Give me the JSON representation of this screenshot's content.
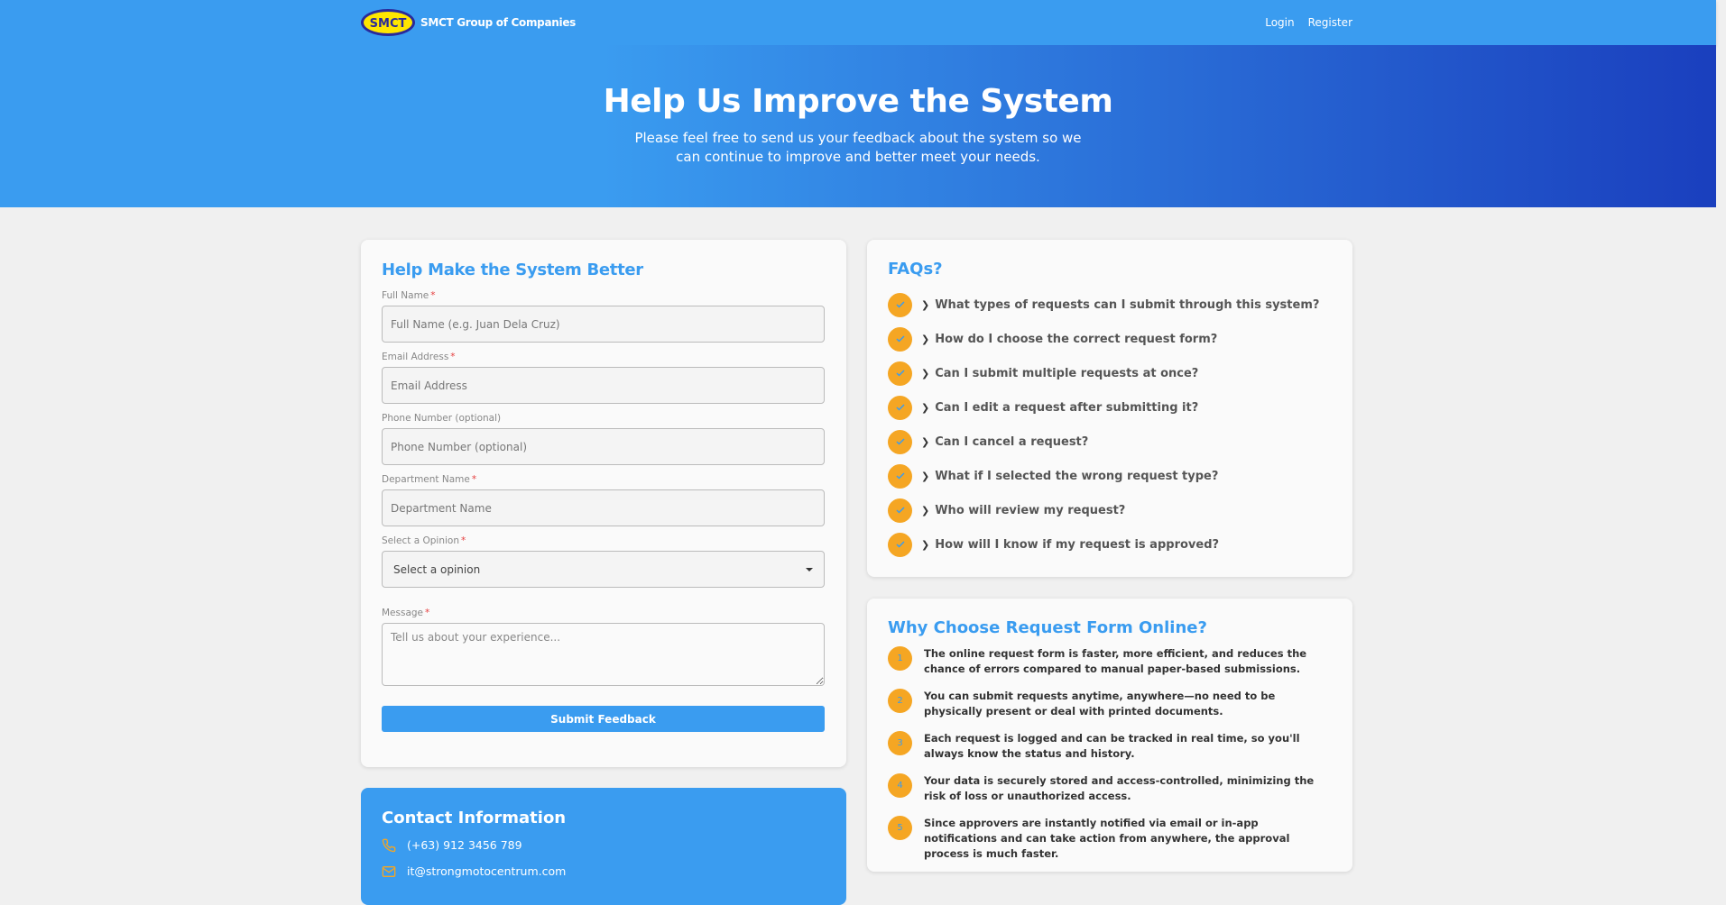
{
  "nav": {
    "logo_text": "SMCT",
    "brand": "SMCT Group of Companies",
    "login": "Login",
    "register": "Register"
  },
  "hero": {
    "title": "Help Us Improve the System",
    "subtitle": "Please feel free to send us your feedback about the system so we can continue to improve and better meet your needs."
  },
  "form": {
    "title": "Help Make the System Better",
    "required_mark": "*",
    "full_name": {
      "label": "Full Name",
      "placeholder": "Full Name (e.g. Juan Dela Cruz)"
    },
    "email": {
      "label": "Email Address",
      "placeholder": "Email Address"
    },
    "phone": {
      "label": "Phone Number (optional)",
      "placeholder": "Phone Number (optional)"
    },
    "department": {
      "label": "Department Name",
      "placeholder": "Department Name"
    },
    "opinion": {
      "label": "Select a Opinion",
      "selected": "Select a opinion"
    },
    "message": {
      "label": "Message",
      "placeholder": "Tell us about your experience..."
    },
    "submit": "Submit Feedback"
  },
  "contact": {
    "title": "Contact Information",
    "phone": "(+63) 912 3456 789",
    "email": "it@strongmotocentrum.com"
  },
  "faq": {
    "title": "FAQs?",
    "items": [
      "What types of requests can I submit through this system?",
      "How do I choose the correct request form?",
      "Can I submit multiple requests at once?",
      "Can I edit a request after submitting it?",
      "Can I cancel a request?",
      "What if I selected the wrong request type?",
      "Who will review my request?",
      "How will I know if my request is approved?"
    ]
  },
  "why": {
    "title": "Why Choose Request Form Online?",
    "items": [
      {
        "num": "1",
        "text": "The online request form is faster, more efficient, and reduces the chance of errors compared to manual paper-based submissions."
      },
      {
        "num": "2",
        "text": "You can submit requests anytime, anywhere—no need to be physically present or deal with printed documents."
      },
      {
        "num": "3",
        "text": "Each request is logged and can be tracked in real time, so you'll always know the status and history."
      },
      {
        "num": "4",
        "text": "Your data is securely stored and access-controlled, minimizing the risk of loss or unauthorized access."
      },
      {
        "num": "5",
        "text": "Since approvers are instantly notified via email or in-app notifications and can take action from anywhere, the approval process is much faster."
      }
    ]
  },
  "colors": {
    "primary": "#3a9cf0",
    "hero_end": "#1a3fbe",
    "accent": "#f5a623",
    "required": "#e53e3e"
  }
}
